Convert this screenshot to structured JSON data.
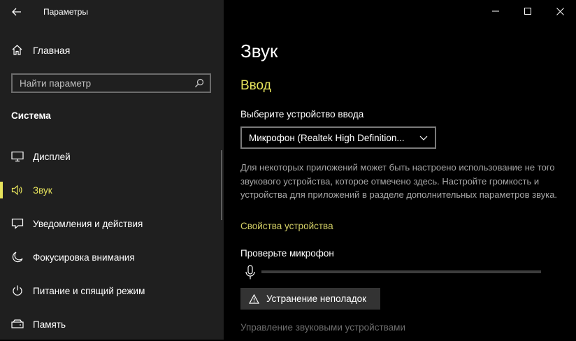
{
  "window": {
    "app_title": "Параметры"
  },
  "sidebar": {
    "home_label": "Главная",
    "search_placeholder": "Найти параметр",
    "section_label": "Система",
    "items": [
      {
        "label": "Дисплей",
        "icon": "display-icon",
        "active": false
      },
      {
        "label": "Звук",
        "icon": "speaker-icon",
        "active": true
      },
      {
        "label": "Уведомления и действия",
        "icon": "notification-icon",
        "active": false
      },
      {
        "label": "Фокусировка внимания",
        "icon": "moon-icon",
        "active": false
      },
      {
        "label": "Питание и спящий режим",
        "icon": "power-icon",
        "active": false
      },
      {
        "label": "Память",
        "icon": "storage-icon",
        "active": false
      }
    ]
  },
  "main": {
    "page_title": "Звук",
    "section_title": "Ввод",
    "select_label": "Выберите устройство ввода",
    "selected_device": "Микрофон (Realtek High Definition...",
    "info_text": "Для некоторых приложений может быть настроено использование не того звукового устройства, которое отмечено здесь. Настройте громкость и устройства для приложений в разделе дополнительных параметров звука.",
    "device_properties_link": "Свойства устройства",
    "mic_test_label": "Проверьте микрофон",
    "mic_level": 0,
    "troubleshoot_label": "Устранение неполадок",
    "manage_devices_link": "Управление звуковыми устройствами"
  },
  "colors": {
    "accent": "#e6e35c",
    "sidebar_bg": "#1f1f1f",
    "main_bg": "#000000",
    "secondary_text": "#a6a6a6"
  }
}
